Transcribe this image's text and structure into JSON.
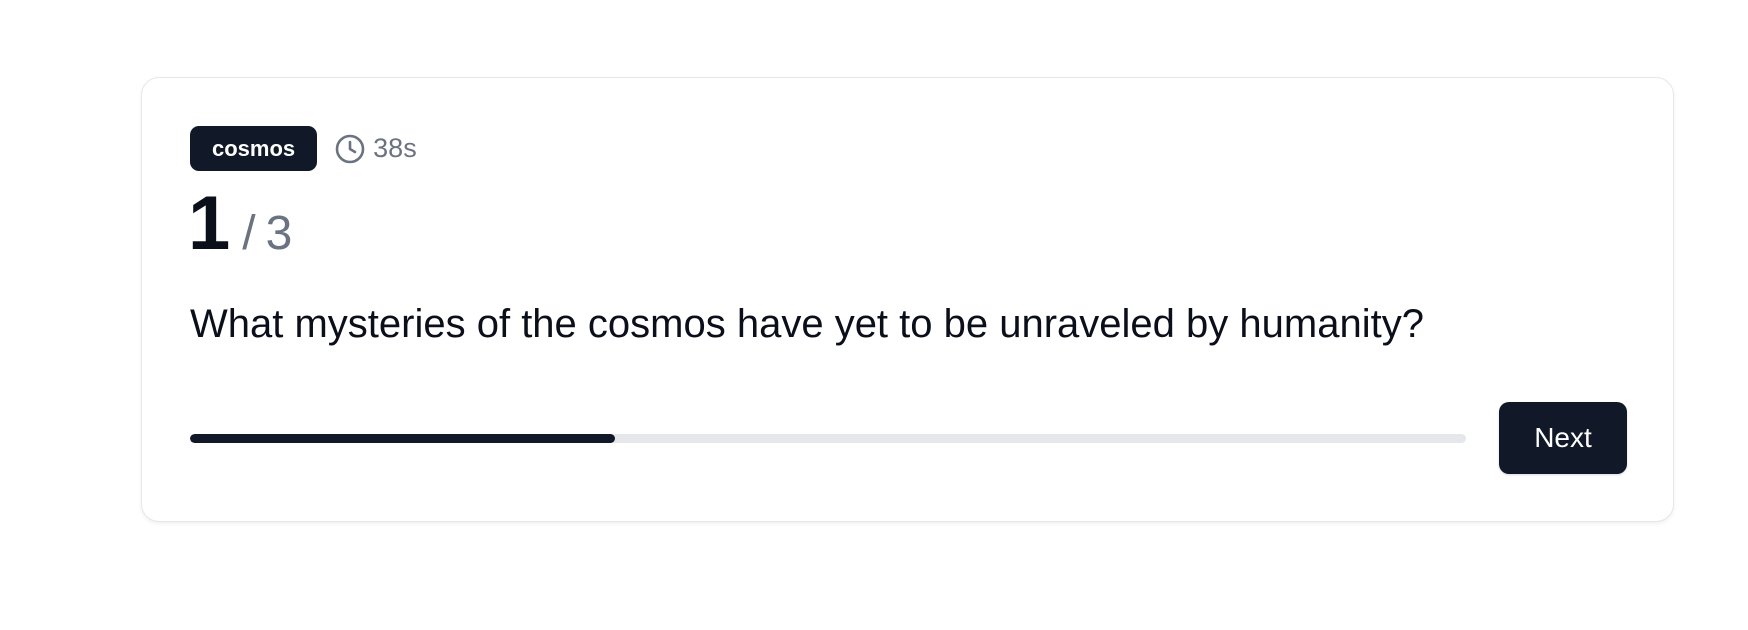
{
  "quiz": {
    "category": "cosmos",
    "timer": "38s",
    "current": "1",
    "separator": "/",
    "total": "3",
    "question": "What mysteries of the cosmos have yet to be unraveled by humanity?",
    "progress_fraction": 0.333,
    "next_label": "Next"
  },
  "icons": {
    "timer": "clock-icon"
  },
  "colors": {
    "primary": "#111827",
    "muted": "#6b7280",
    "track": "#e5e7eb",
    "border": "#e5e7eb"
  }
}
